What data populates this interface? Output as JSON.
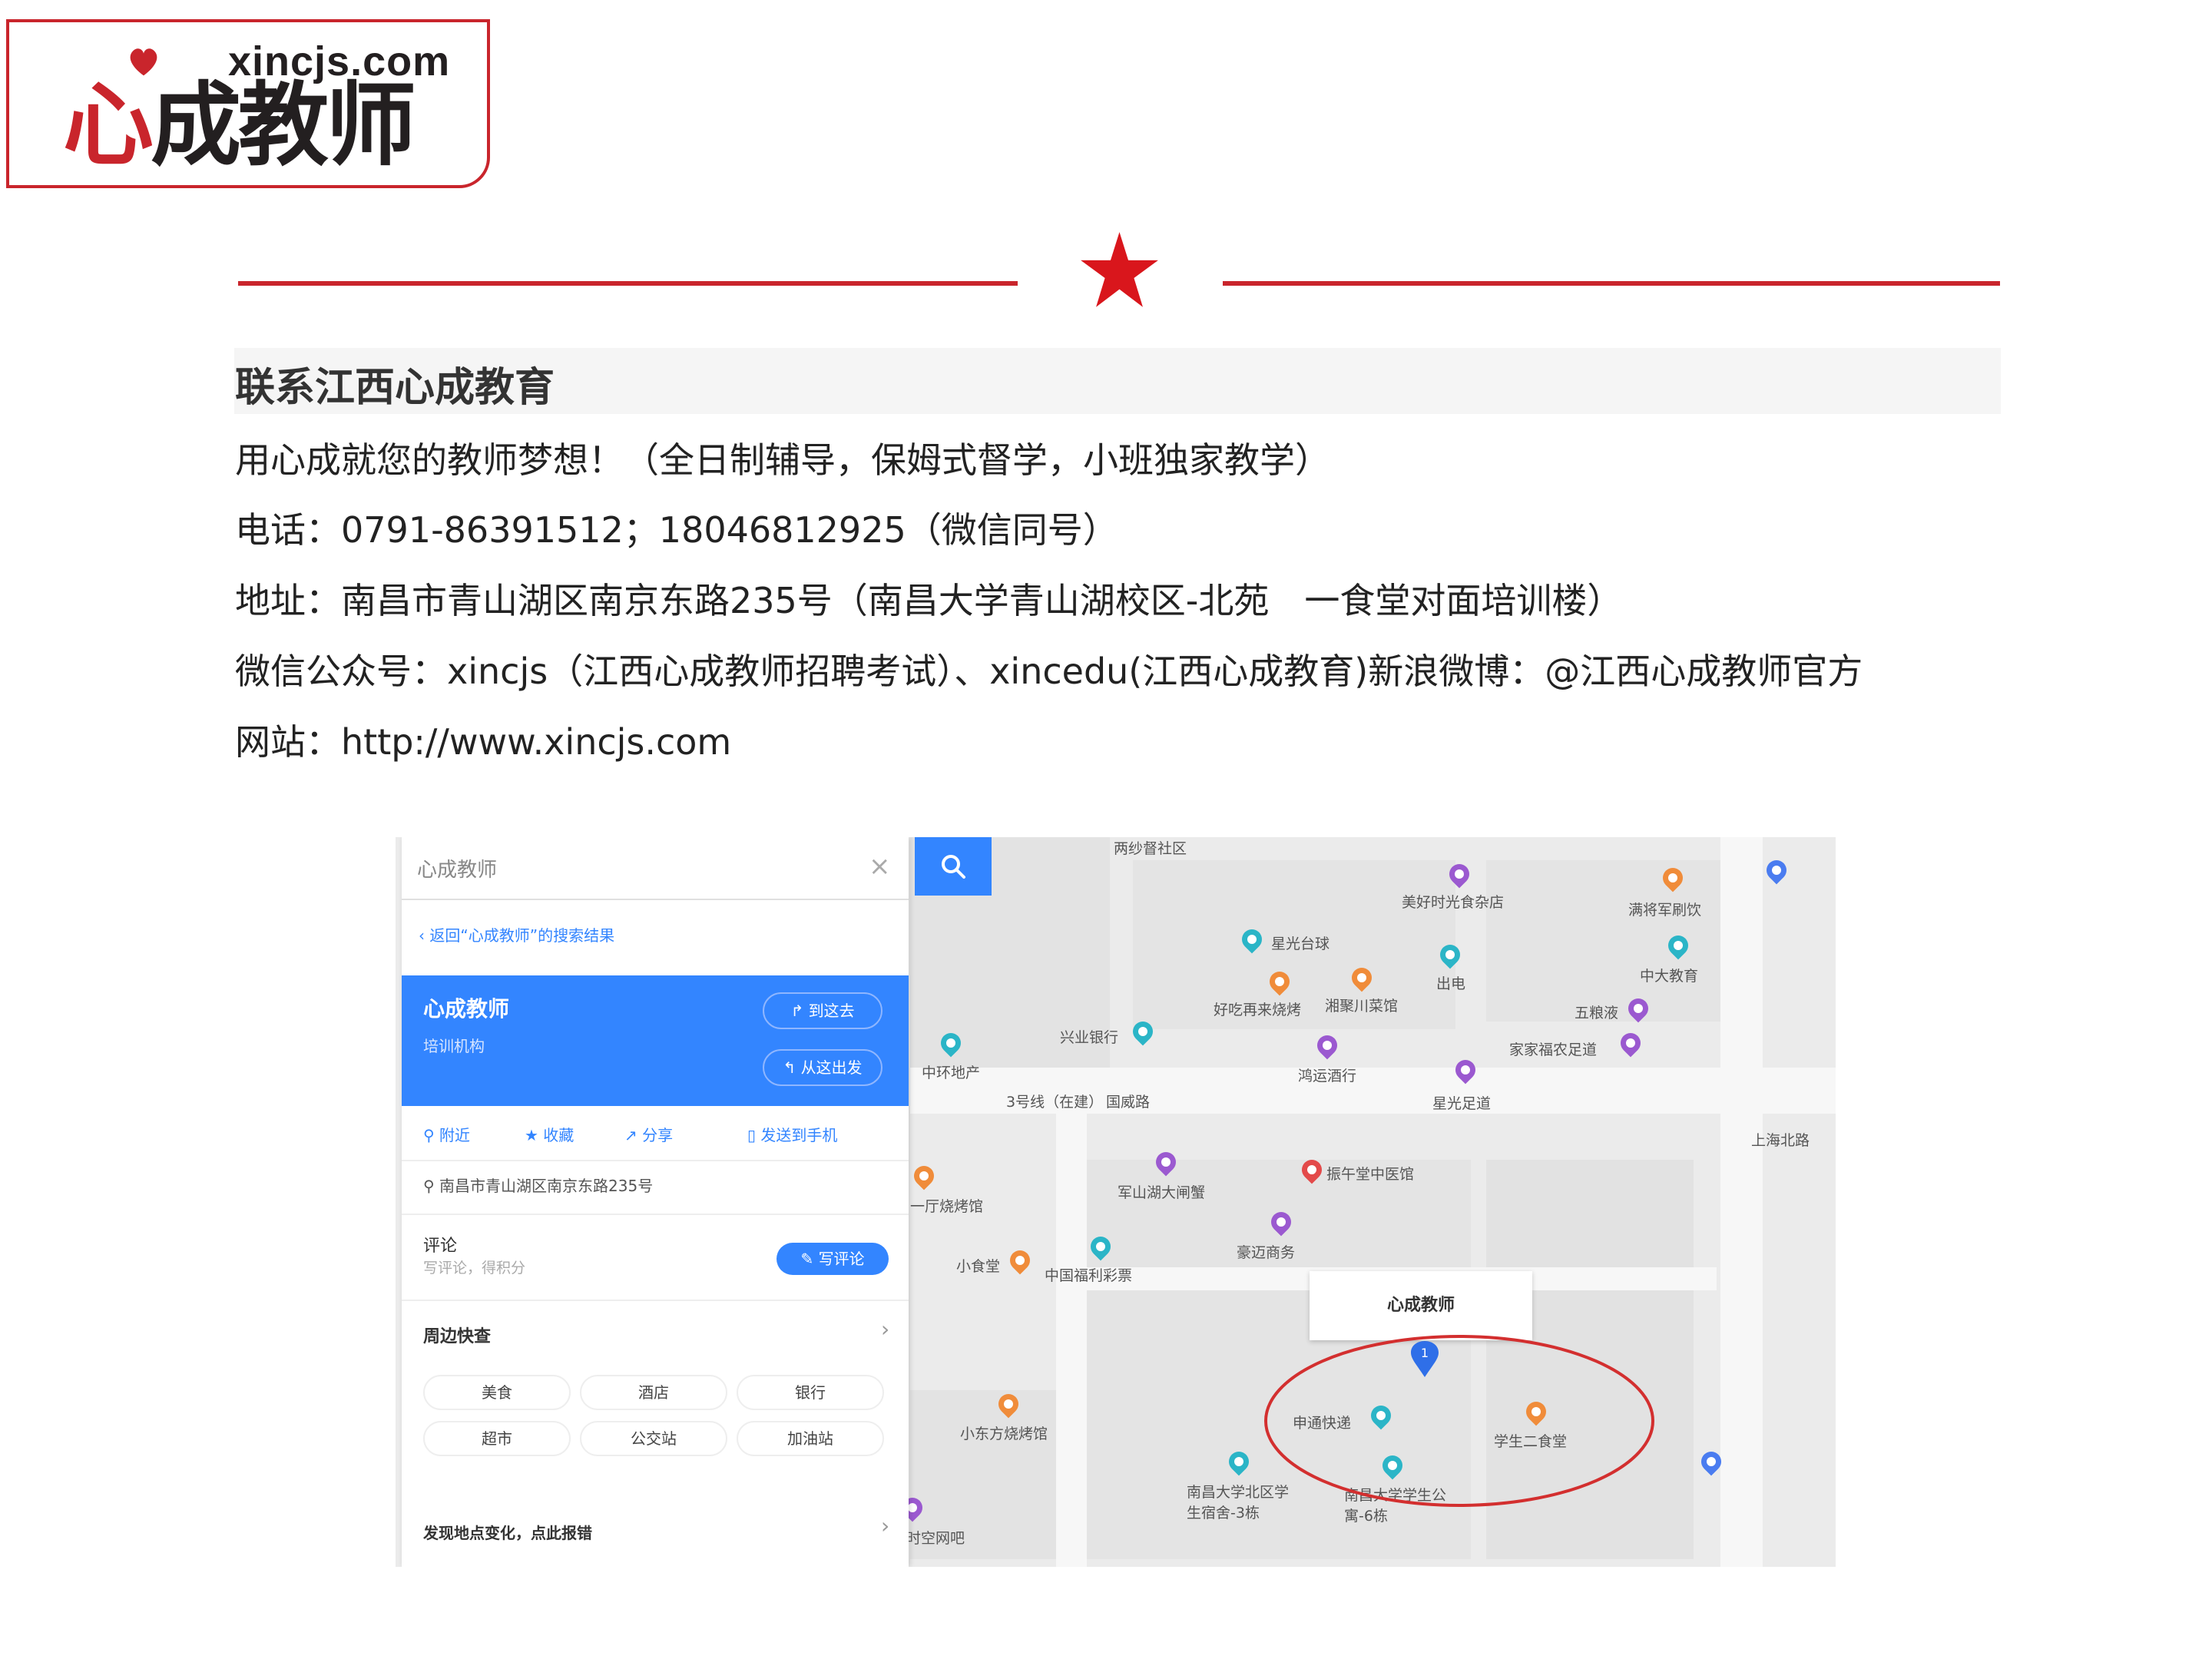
{
  "logo": {
    "domain": "xincjs.com",
    "name_first": "心",
    "name_rest": "成教师",
    "brand_color": "#c9252c"
  },
  "contact": {
    "title": "联系江西心成教育",
    "slogan": "用心成就您的教师梦想！（全日制辅导，保姆式督学，小班独家教学）",
    "phone": "电话：0791-86391512；18046812925（微信同号）",
    "address": "地址：南昌市青山湖区南京东路235号（南昌大学青山湖校区-北苑　一食堂对面培训楼）",
    "wechat": "微信公众号：xincjs（江西心成教师招聘考试）、xincedu(江西心成教育)新浪微博：@江西心成教师官方",
    "website": "网站：http://www.xincjs.com"
  },
  "map": {
    "search_value": "心成教师",
    "search_icon": "search-icon",
    "back_link": "返回“心成教师”的搜索结果",
    "place_name": "心成教师",
    "place_type": "培训机构",
    "btn_to_here": "到这去",
    "btn_from_here": "从这出发",
    "actions": [
      "附近",
      "收藏",
      "分享",
      "发送到手机"
    ],
    "address": "南昌市青山湖区南京东路235号",
    "review_title": "评论",
    "review_sub": "写评论，得积分",
    "review_btn": "写评论",
    "nearby_title": "周边快查",
    "categories": [
      "美食",
      "酒店",
      "银行",
      "超市",
      "公交站",
      "加油站"
    ],
    "report": "发现地点变化，点此报错",
    "marker_label": "心成教师",
    "marker_number": "1",
    "pois": [
      "两纱督社区",
      "美好时光食杂店",
      "满将军刷饮",
      "星光台球",
      "中大教育",
      "出电",
      "好吃再来烧烤",
      "湘聚川菜馆",
      "五粮液",
      "兴业银行",
      "中环地产",
      "鸿运酒行",
      "家家福农足道",
      "3号线（在建）",
      "国威路",
      "星光足道",
      "上海北路",
      "军山湖大闸蟹",
      "振午堂中医馆",
      "一厅烧烤馆",
      "豪迈商务",
      "小食堂",
      "中国福利彩票",
      "申通快递",
      "学生二食堂",
      "小东方烧烤馆",
      "南昌大学北区学生宿舍-3栋",
      "南昌大学学生公寓-6栋",
      "时空网吧"
    ]
  }
}
